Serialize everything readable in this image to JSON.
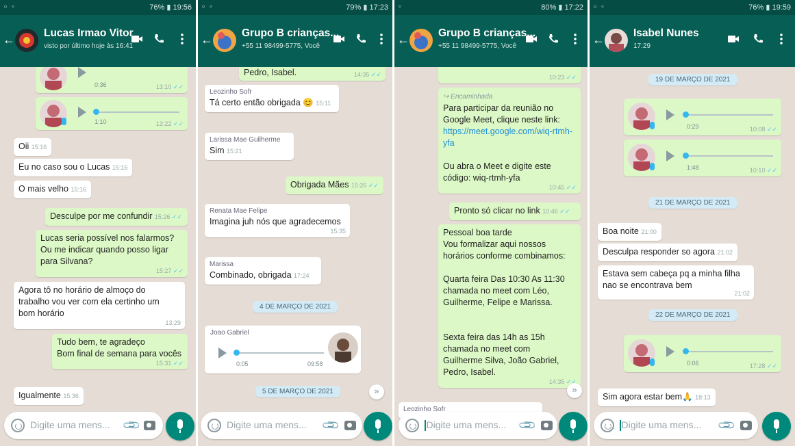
{
  "screens": [
    {
      "status": {
        "right": "76% ▮ 19:56"
      },
      "header": {
        "title": "Lucas Irmao Vitor",
        "subtitle": "visto por último hoje às 16:41"
      },
      "audios": [
        {
          "duration": "0:36",
          "time": "13:10"
        },
        {
          "duration": "1:10",
          "time": "13:22"
        }
      ],
      "messages": [
        {
          "text": "Oii",
          "time": "15:16"
        },
        {
          "text": "Eu no caso sou o Lucas",
          "time": "15:16"
        },
        {
          "text": "O mais velho",
          "time": "15:16"
        },
        {
          "text": "Desculpe por me confundir",
          "time": "15:26"
        },
        {
          "text": "Lucas seria possível  nos falarmos?\nOu me indicar quando posso ligar\npara Silvana?",
          "time": "15:27"
        },
        {
          "text": "Agora tô no horário de almoço do\ntrabalho vou ver com ela certinho um\nbom horário",
          "time": "13:29"
        },
        {
          "text": "Tudo bem, te agradeço\nBom final de semana para vocês",
          "time": "15:31"
        },
        {
          "text": "Igualmente",
          "time": "15:36"
        }
      ],
      "input": {
        "placeholder": "Digite uma mens..."
      }
    },
    {
      "status": {
        "right": "79% ▮ 17:23"
      },
      "header": {
        "title": "Grupo B crianças...",
        "subtitle": "+55 11 98499-5775, Você"
      },
      "messages": [
        {
          "text": "Pedro, Isabel.",
          "time": "14:35"
        },
        {
          "sender": "Leozinho Sofr",
          "text": "Tá certo então obrigada 😊",
          "time": "15:11"
        },
        {
          "sender": "Larissa Mae Guilherme",
          "text": "Sim",
          "time": "15:21"
        },
        {
          "text": "Obrigada Mães",
          "time": "15:26"
        },
        {
          "sender": "Renata Mae Felipe",
          "text": "Imagina juh nós que agradecemos",
          "time": "15:35"
        },
        {
          "sender": "Marissa",
          "text": "Combinado, obrigada",
          "time": "17:24"
        },
        {
          "sender": "Joao Gabriel",
          "text": "",
          "time": "09:58"
        }
      ],
      "dates": [
        "4 DE MARÇO DE 2021",
        "5 DE MARÇO DE 2021"
      ],
      "audio": {
        "duration": "0:05"
      },
      "input": {
        "placeholder": "Digite uma mens..."
      }
    },
    {
      "status": {
        "right": "80% ▮ 17:22"
      },
      "header": {
        "title": "Grupo B crianças...",
        "subtitle": "+55 11 98499-5775, Você"
      },
      "messages": [
        {
          "text": "",
          "time": "10:23"
        },
        {
          "forwarded": "Encaminhada",
          "text_before": "Para participar da reunião no\nGoogle Meet, clique neste link:",
          "link": "https://meet.google.com/wiq-rtmh-yfa",
          "text_after": "Ou abra o Meet e digite este\ncódigo: wiq-rtmh-yfa",
          "time": "10:45"
        },
        {
          "text": "Pronto só  clicar no link",
          "time": "10:46"
        },
        {
          "text": "Pessoal boa tarde\nVou formalizar aqui nossos\nhorários  conforme combinamos:\n\nQuarta feira Das 10:30 As 11:30\nchamada no meet com Léo,\nGuilherme, Felipe e Marissa.\n\n\nSexta feira das 14h as 15h\nchamada no meet  com\nGuilherme Silva, João Gabriel,\nPedro, Isabel.",
          "time": "14:35"
        },
        {
          "text": "Leozinho Sofr",
          "time": ""
        }
      ],
      "input": {
        "placeholder": "Digite uma mens..."
      }
    },
    {
      "status": {
        "right": "76% ▮ 19:59"
      },
      "header": {
        "title": "Isabel Nunes",
        "subtitle": "17:29"
      },
      "dates": [
        "19 DE MARÇO DE 2021",
        "21 DE MARÇO DE 2021",
        "22 DE MARÇO DE 2021"
      ],
      "audios": [
        {
          "duration": "0:29",
          "time": "10:08"
        },
        {
          "duration": "1:48",
          "time": "10:10"
        },
        {
          "duration": "0:06",
          "time": "17:28"
        }
      ],
      "messages": [
        {
          "text": "Boa noite",
          "time": "21:00"
        },
        {
          "text": "Desculpa responder so agora",
          "time": "21:02"
        },
        {
          "text": "Estava sem cabeça pq a minha filha\nnao se encontrava bem",
          "time": "21:02"
        },
        {
          "text": "Sim agora estar bem🙏",
          "time": "18:13"
        }
      ],
      "input": {
        "placeholder": "Digite uma mens..."
      }
    }
  ],
  "colors": {
    "header": "#075e54",
    "statusbar": "#054d44",
    "outgoing": "#dcf8c6",
    "incoming": "#ffffff",
    "chat_bg": "#e5ddd5",
    "read_tick": "#4fc3f7",
    "mic_button": "#00897b"
  }
}
